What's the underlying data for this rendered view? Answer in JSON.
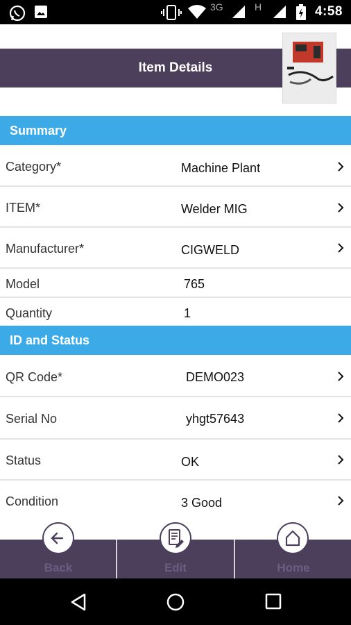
{
  "status_bar": {
    "time": "4:58",
    "network": "3G",
    "network2": "H",
    "icons": [
      "whatsapp-icon",
      "image-icon",
      "vibrate-icon",
      "wifi-icon",
      "signal-icon",
      "signal-icon",
      "battery-charging-icon"
    ]
  },
  "header": {
    "title": "Item Details"
  },
  "sections": {
    "summary": "Summary",
    "id_status": "ID and Status"
  },
  "summary_rows": [
    {
      "label": "Category*",
      "value": "Machine Plant"
    },
    {
      "label": "ITEM*",
      "value": "Welder MIG"
    },
    {
      "label": "Manufacturer*",
      "value": "CIGWELD"
    },
    {
      "label": "Model",
      "value": "765"
    },
    {
      "label": "Quantity",
      "value": "1"
    }
  ],
  "id_rows": [
    {
      "label": "QR Code*",
      "value": "DEMO023"
    },
    {
      "label": "Serial No",
      "value": "yhgt57643"
    },
    {
      "label": "Status",
      "value": "OK"
    },
    {
      "label": "Condition",
      "value": "3 Good"
    }
  ],
  "bottom_nav": {
    "back": "Back",
    "edit": "Edit",
    "home": "Home"
  },
  "colors": {
    "header": "#4b3f5b",
    "section": "#3daae8"
  }
}
